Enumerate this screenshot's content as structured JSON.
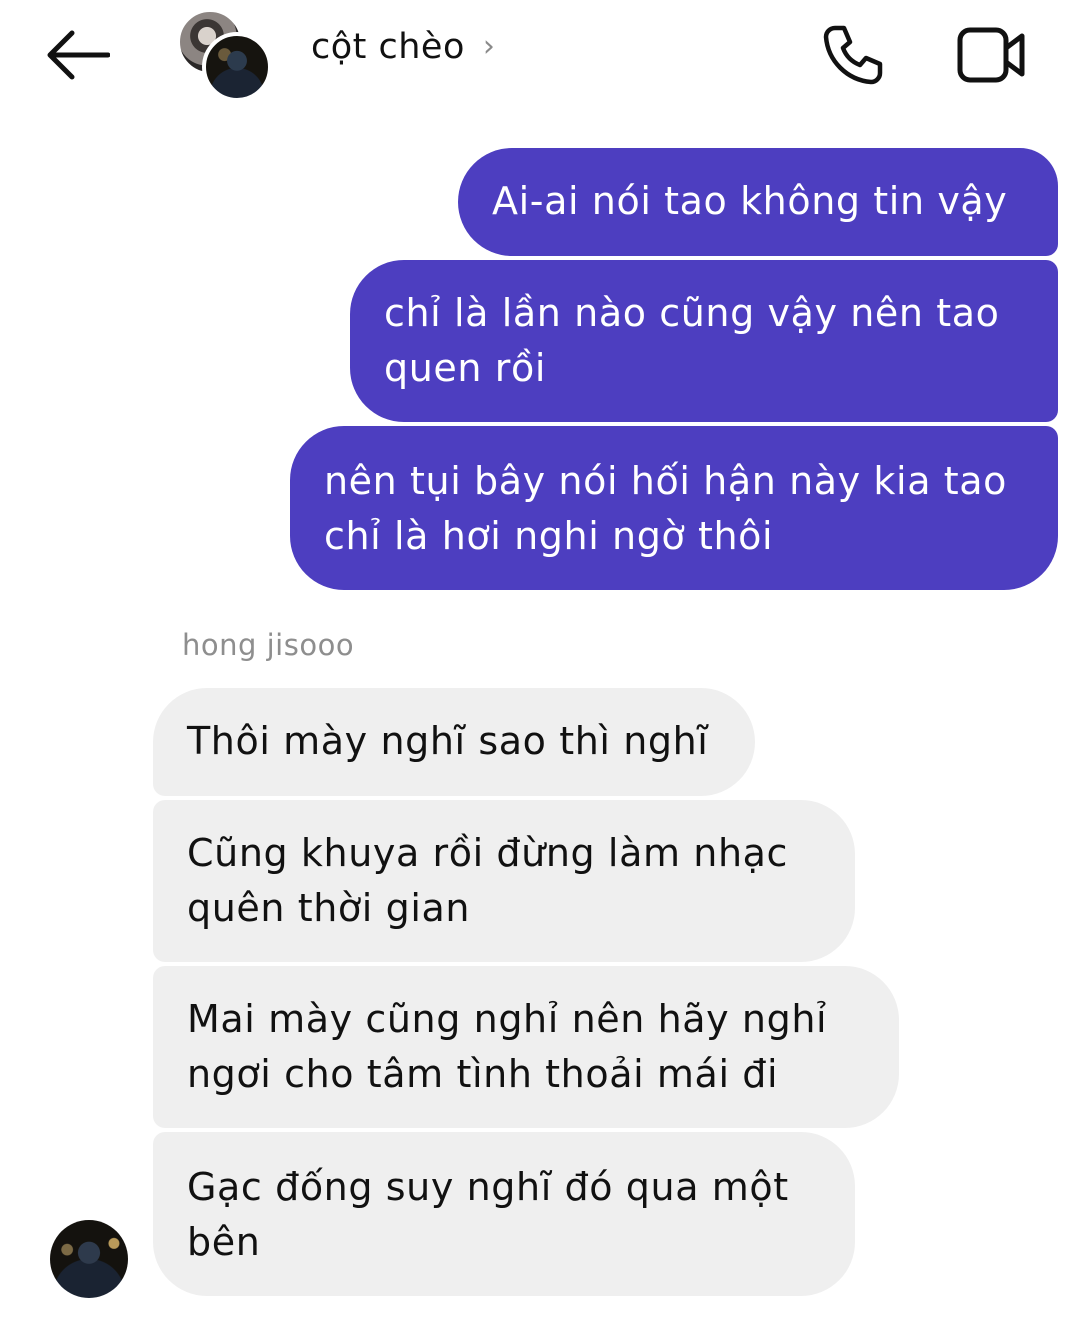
{
  "header": {
    "title": "cột chèo",
    "chevron": "›",
    "icons": {
      "back": "arrow-left-icon",
      "call": "phone-icon",
      "video": "video-camera-icon",
      "chevron": "chevron-right-icon"
    }
  },
  "messages": {
    "outgoing": [
      {
        "lines": [
          "Ai-ai nói tao không tin vậy"
        ]
      },
      {
        "lines": [
          "chỉ là lần nào cũng vậy nên tao",
          "quen rồi"
        ]
      },
      {
        "lines": [
          "nên tụi bây nói hối hận này kia tao",
          "chỉ là hơi nghi ngờ thôi"
        ]
      }
    ],
    "incoming_sender": "hong jisooo",
    "incoming": [
      {
        "lines": [
          "Thôi mày nghĩ sao thì nghĩ"
        ]
      },
      {
        "lines": [
          "Cũng khuya rồi đừng làm nhạc",
          "quên thời gian"
        ]
      },
      {
        "lines": [
          "Mai mày cũng nghỉ nên hãy nghỉ",
          "ngơi cho tâm tình thoải mái đi"
        ]
      },
      {
        "lines": [
          "Gạc đống suy nghĩ đó qua một",
          "bên"
        ]
      }
    ]
  },
  "colors": {
    "outgoing_bubble": "#4d3ec0",
    "incoming_bubble": "#efefef",
    "sender_name": "#8e8e8e"
  }
}
